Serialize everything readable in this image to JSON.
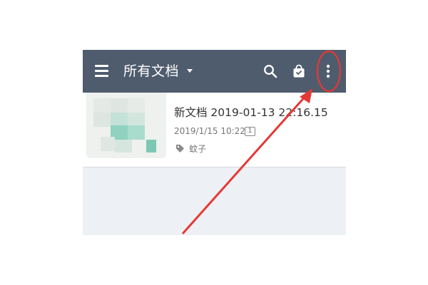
{
  "app_bar": {
    "title": "所有文档",
    "background": "#4f5c6e",
    "icons": [
      "menu-icon",
      "search-icon",
      "bag-icon",
      "more-vert-icon"
    ]
  },
  "documents": [
    {
      "title": "新文档 2019-01-13 22:16.15",
      "date": "2019/1/15 10:22",
      "page_count": "1",
      "tag_icon": "tag-icon",
      "tag": "蚊子"
    }
  ],
  "annotation": {
    "circle_color": "#e53935",
    "arrow_color": "#e53935",
    "target": "more-vert-icon"
  }
}
